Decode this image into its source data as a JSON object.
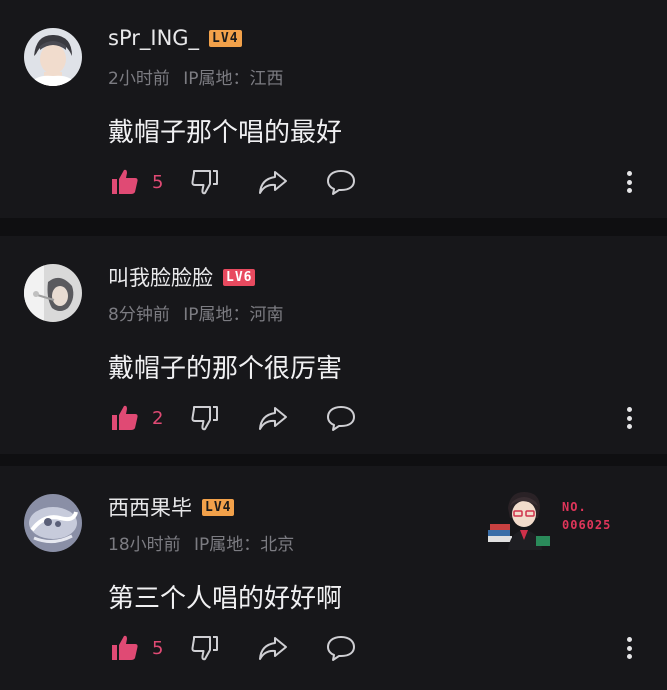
{
  "colors": {
    "background": "#0f0f11",
    "card": "#17171a",
    "accent": "#e04a74",
    "level_orange": "#f2a14a",
    "level_red": "#e84a5f"
  },
  "comments": [
    {
      "username": "sPr_ING_",
      "level": "LV4",
      "time": "2小时前",
      "ip": "IP属地：江西",
      "text": "戴帽子那个唱的最好",
      "likes": "5"
    },
    {
      "username": "叫我脸脸脸",
      "level": "LV6",
      "time": "8分钟前",
      "ip": "IP属地：河南",
      "text": "戴帽子的那个很厉害",
      "likes": "2"
    },
    {
      "username": "西西果毕",
      "level": "LV4",
      "time": "18小时前",
      "ip": "IP属地：北京",
      "text": "第三个人唱的好好啊",
      "likes": "5",
      "badge": {
        "line1": "NO.",
        "line2": "006025"
      }
    }
  ],
  "icons": [
    "like-icon",
    "dislike-icon",
    "share-icon",
    "reply-icon",
    "more-icon"
  ]
}
